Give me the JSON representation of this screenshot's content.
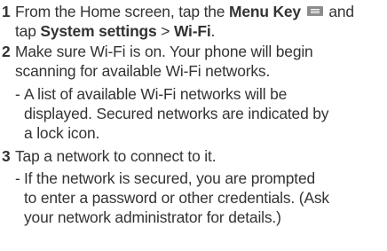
{
  "steps": [
    {
      "number": "1",
      "line1": {
        "t1": "From the Home screen, tap the ",
        "b1": "Menu Key",
        "t2": " and",
        "icon": "menu-key-icon"
      },
      "line2": {
        "t1": "tap ",
        "b1": "System settings",
        "t2": " > ",
        "b2": "Wi-Fi",
        "t3": "."
      }
    },
    {
      "number": "2",
      "lines": [
        "Make sure Wi-Fi is on. Your phone will begin",
        "scanning for available Wi-Fi networks."
      ],
      "sub": {
        "dash": "-",
        "lines": [
          "A list of available Wi-Fi networks will be",
          "displayed. Secured networks are indicated by",
          "a lock icon."
        ]
      }
    },
    {
      "number": "3",
      "lines": [
        "Tap a network to connect to it."
      ],
      "sub": {
        "dash": "-",
        "lines": [
          "If the network is secured, you are prompted",
          "to enter a password or other credentials. (Ask",
          "your network administrator for details.)"
        ]
      }
    }
  ]
}
